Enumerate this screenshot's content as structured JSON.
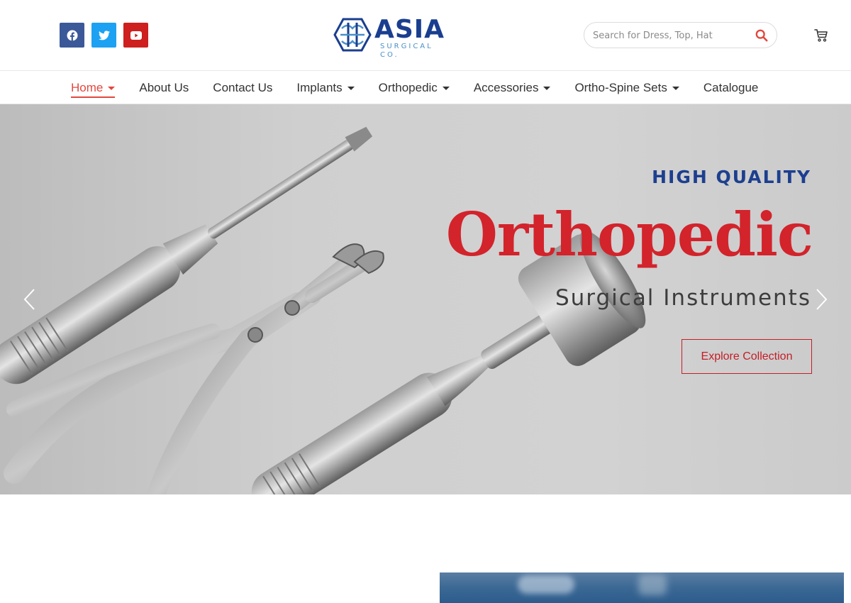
{
  "header": {
    "social": [
      {
        "name": "facebook",
        "icon": "facebook-icon",
        "color": "#3b5998"
      },
      {
        "name": "twitter",
        "icon": "twitter-icon",
        "color": "#1da1f2"
      },
      {
        "name": "youtube",
        "icon": "youtube-icon",
        "color": "#cd201f"
      }
    ],
    "logo": {
      "title": "ASIA",
      "subtitle": "SURGICAL CO."
    },
    "search": {
      "placeholder": "Search for Dress, Top, Hat",
      "icon": "search-icon"
    },
    "cart": {
      "icon": "cart-icon"
    }
  },
  "nav": {
    "items": [
      {
        "label": "Home",
        "active": true,
        "dropdown": true
      },
      {
        "label": "About Us",
        "active": false,
        "dropdown": false
      },
      {
        "label": "Contact Us",
        "active": false,
        "dropdown": false
      },
      {
        "label": "Implants",
        "active": false,
        "dropdown": true
      },
      {
        "label": "Orthopedic",
        "active": false,
        "dropdown": true
      },
      {
        "label": "Accessories",
        "active": false,
        "dropdown": true
      },
      {
        "label": "Ortho-Spine Sets",
        "active": false,
        "dropdown": true
      },
      {
        "label": "Catalogue",
        "active": false,
        "dropdown": false
      }
    ]
  },
  "hero": {
    "kicker": "HIGH QUALITY",
    "headline": "Orthopedic",
    "subheadline": "Surgical Instruments",
    "cta": "Explore Collection",
    "colors": {
      "kicker": "#1d3f8f",
      "headline": "#d3232b",
      "cta": "#c41e27"
    }
  },
  "colors": {
    "accent": "#e2483e",
    "brand_blue": "#1a3e8f"
  }
}
